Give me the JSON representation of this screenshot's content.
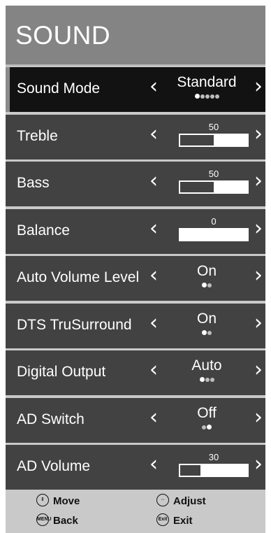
{
  "header": {
    "title": "SOUND"
  },
  "rows": [
    {
      "label": "Sound Mode",
      "type": "select",
      "value": "Standard",
      "dots_total": 5,
      "dots_selected": 1,
      "selected": true
    },
    {
      "label": "Treble",
      "type": "slider",
      "value": "50",
      "level": 50
    },
    {
      "label": "Bass",
      "type": "slider",
      "value": "50",
      "level": 50
    },
    {
      "label": "Balance",
      "type": "slider",
      "value": "0",
      "level": 0
    },
    {
      "label": "Auto Volume Level",
      "type": "select",
      "value": "On",
      "dots_total": 2,
      "dots_selected": 1
    },
    {
      "label": "DTS TruSurround",
      "type": "select",
      "value": "On",
      "dots_total": 2,
      "dots_selected": 1
    },
    {
      "label": "Digital Output",
      "type": "select",
      "value": "Auto",
      "dots_total": 3,
      "dots_selected": 1
    },
    {
      "label": "AD Switch",
      "type": "select",
      "value": "Off",
      "dots_total": 2,
      "dots_selected": 2
    },
    {
      "label": "AD Volume",
      "type": "slider",
      "value": "30",
      "level": 30
    }
  ],
  "footer": {
    "move_label": "Move",
    "adjust_label": "Adjust",
    "back_label": "Back",
    "exit_label": "Exit",
    "back_icon_text": "MENU",
    "exit_icon_text": "Exit"
  },
  "arrows": {
    "left": "‹",
    "right": "›"
  },
  "colors": {
    "row_bg": "#424242",
    "selected_bg": "#121212",
    "header_bg": "#848484",
    "footer_bg": "#c9c9c9"
  }
}
